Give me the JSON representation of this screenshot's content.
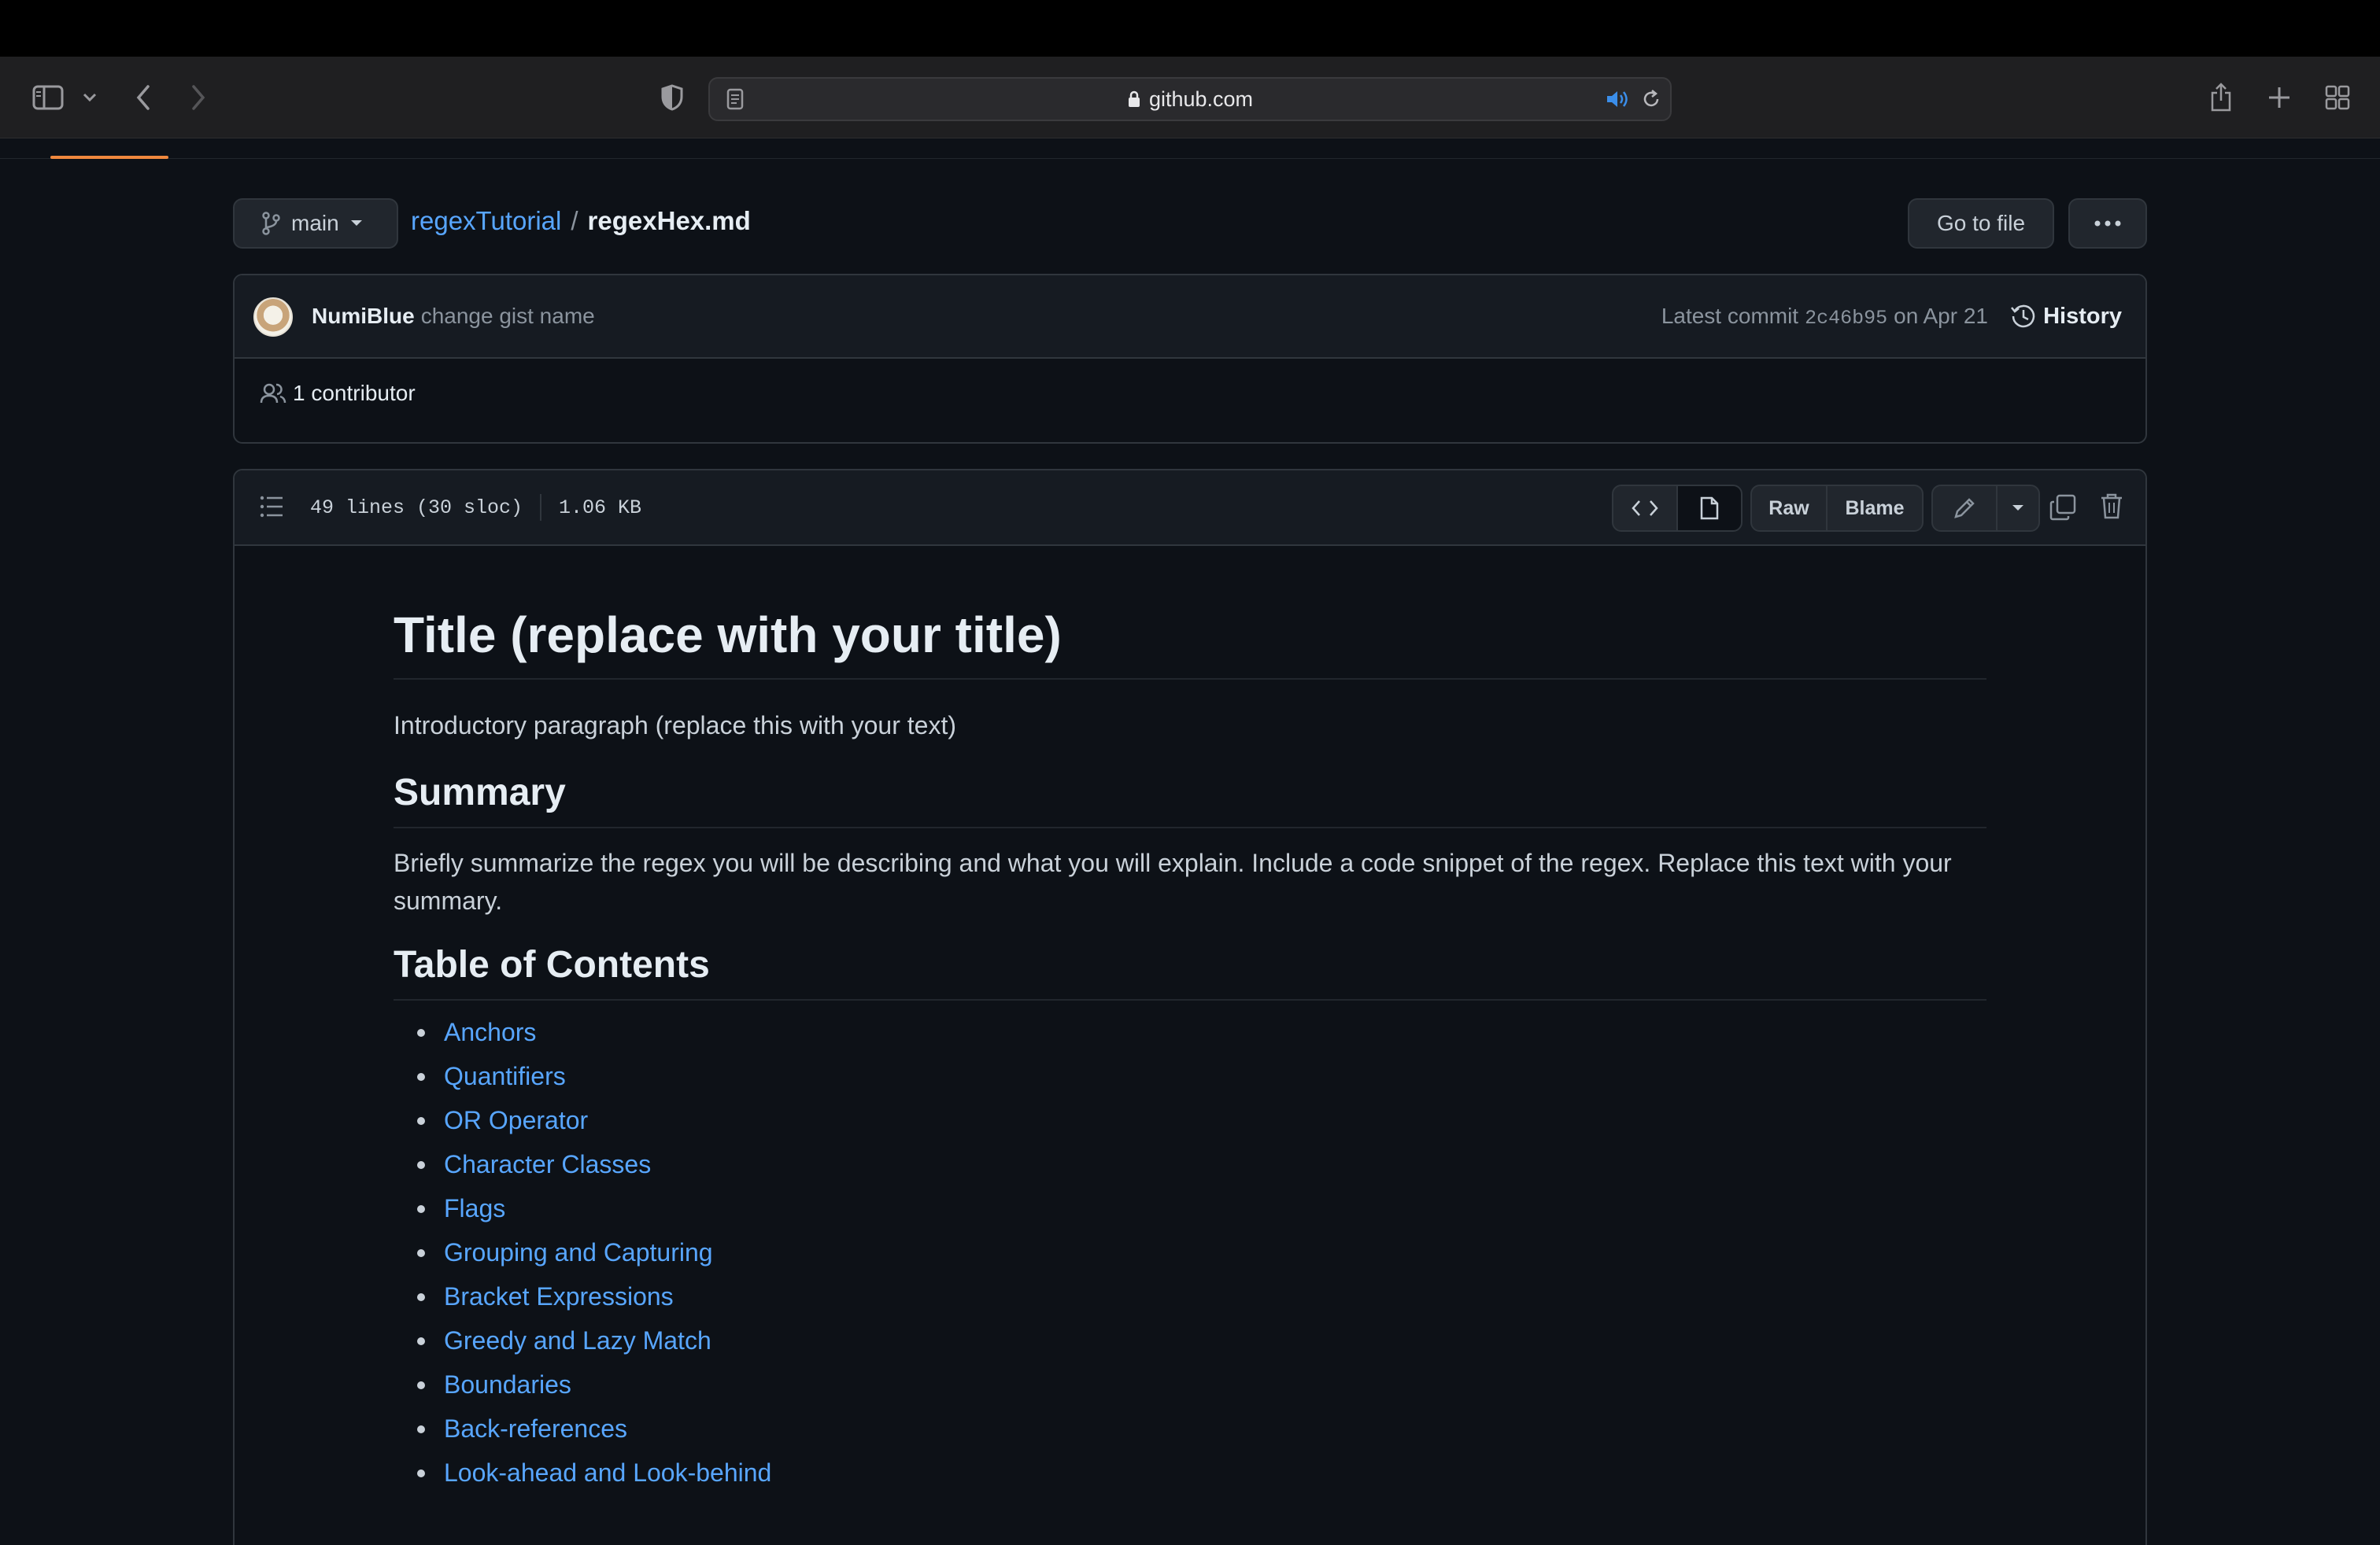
{
  "browser": {
    "url_host": "github.com"
  },
  "repo": {
    "branch": "main",
    "repo_name": "regexTutorial",
    "separator": "/",
    "file_name": "regexHex.md",
    "go_to_file": "Go to file"
  },
  "commit": {
    "author": "NumiBlue",
    "message": "change gist name",
    "latest_label": "Latest commit",
    "sha": "2c46b95",
    "date": "on Apr 21",
    "history": "History",
    "contributors": "1 contributor"
  },
  "file": {
    "lines": "49 lines (30 sloc)",
    "size": "1.06 KB",
    "raw": "Raw",
    "blame": "Blame"
  },
  "content": {
    "title": "Title (replace with your title)",
    "intro": "Introductory paragraph (replace this with your text)",
    "summary_heading": "Summary",
    "summary_text": "Briefly summarize the regex you will be describing and what you will explain. Include a code snippet of the regex. Replace this text with your summary.",
    "toc_heading": "Table of Contents",
    "toc": [
      "Anchors",
      "Quantifiers",
      "OR Operator",
      "Character Classes",
      "Flags",
      "Grouping and Capturing",
      "Bracket Expressions",
      "Greedy and Lazy Match",
      "Boundaries",
      "Back-references",
      "Look-ahead and Look-behind"
    ]
  }
}
